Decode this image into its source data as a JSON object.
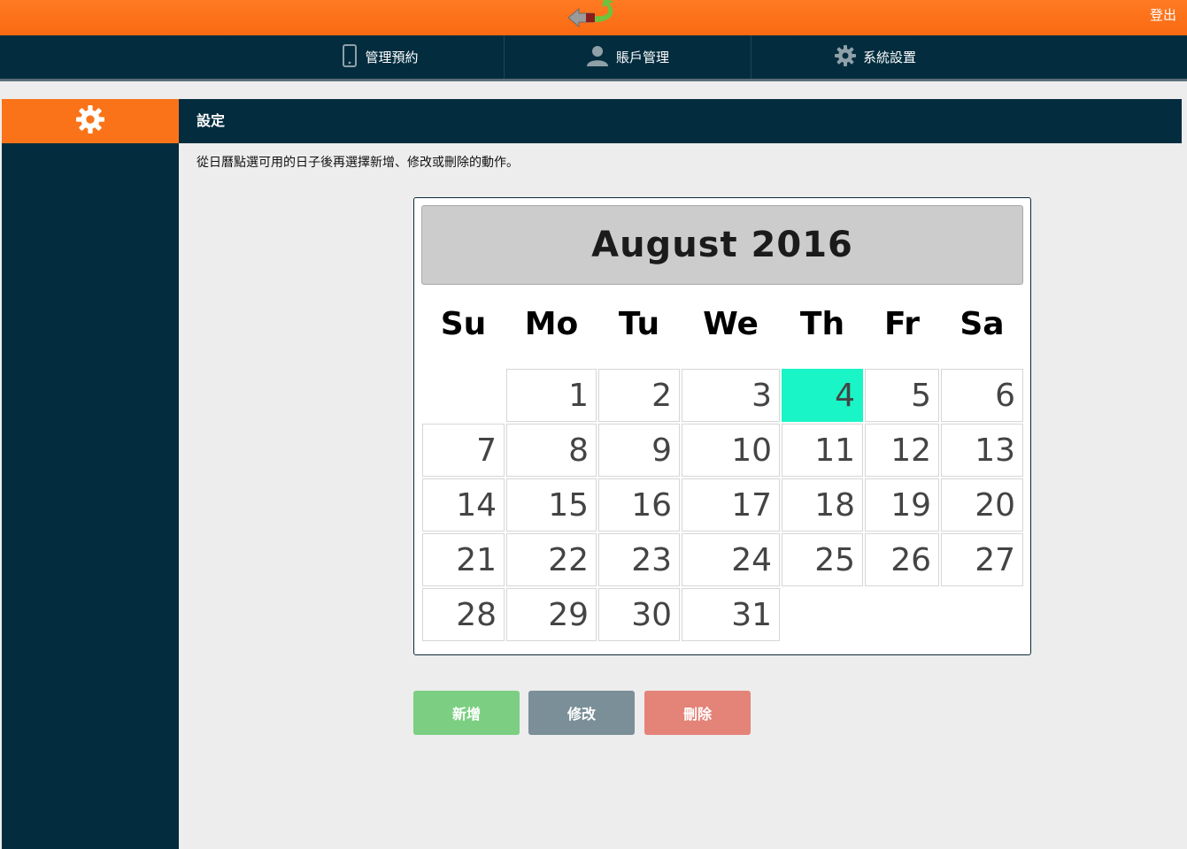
{
  "header": {
    "logout_label": "登出"
  },
  "nav": {
    "items": [
      {
        "label": "管理預約",
        "icon": "phone-icon"
      },
      {
        "label": "賬戶管理",
        "icon": "user-icon"
      },
      {
        "label": "系統設置",
        "icon": "gear-icon"
      }
    ]
  },
  "sidebar": {
    "icon": "gear-icon"
  },
  "page": {
    "title": "設定",
    "instruction": "從日曆點選可用的日子後再選擇新增、修改或刪除的動作。"
  },
  "calendar": {
    "month_title": "August 2016",
    "weekdays": [
      "Su",
      "Mo",
      "Tu",
      "We",
      "Th",
      "Fr",
      "Sa"
    ],
    "selected_day": 4,
    "selected_color": "#19f5c6",
    "days": [
      "1",
      "2",
      "3",
      "4",
      "5",
      "6",
      "7",
      "8",
      "9",
      "10",
      "11",
      "12",
      "13",
      "14",
      "15",
      "16",
      "17",
      "18",
      "19",
      "20",
      "21",
      "22",
      "23",
      "24",
      "25",
      "26",
      "27",
      "28",
      "29",
      "30",
      "31"
    ]
  },
  "actions": {
    "add_label": "新增",
    "edit_label": "修改",
    "delete_label": "刪除",
    "add_color": "#7ccf82",
    "edit_color": "#7b8f98",
    "delete_color": "#e48378"
  },
  "colors": {
    "brand_orange": "#fa7319",
    "navy": "#032d3f"
  }
}
